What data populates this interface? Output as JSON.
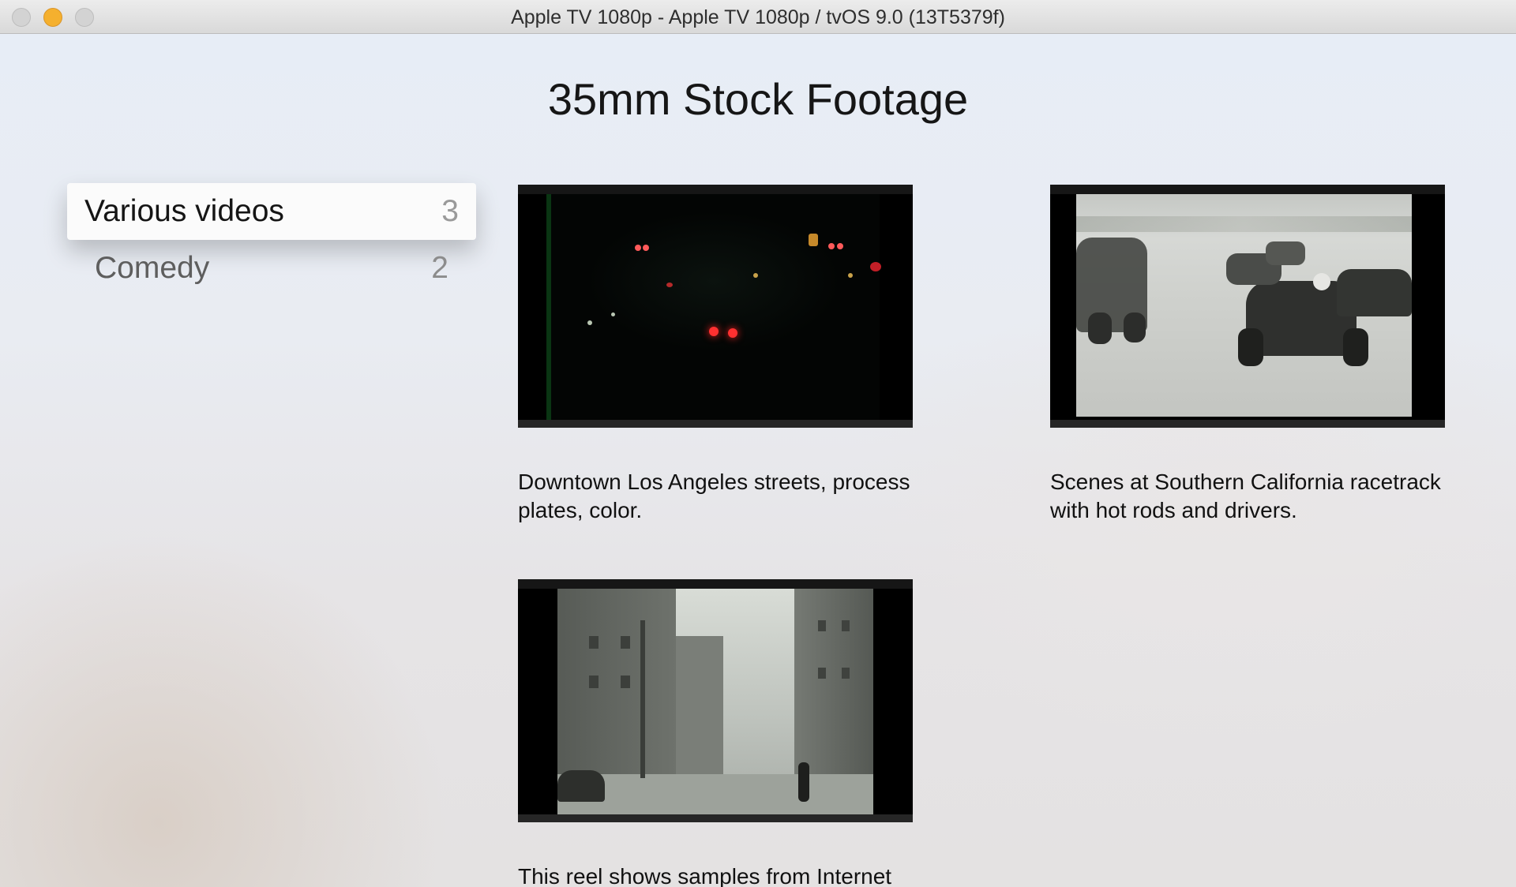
{
  "window": {
    "title": "Apple TV 1080p - Apple TV 1080p / tvOS 9.0 (13T5379f)"
  },
  "page": {
    "title": "35mm Stock Footage"
  },
  "sidebar": {
    "items": [
      {
        "label": "Various videos",
        "count": "3",
        "state": "focused"
      },
      {
        "label": "Comedy",
        "count": "2",
        "state": "normal"
      }
    ]
  },
  "videos": [
    {
      "caption": "Downtown Los Angeles streets, process plates, color."
    },
    {
      "caption": "Scenes at Southern California racetrack with hot rods and drivers."
    },
    {
      "caption": "This reel shows samples from Internet"
    }
  ],
  "colors": {
    "traffic_close": "#d3d3d3",
    "traffic_minimize": "#f5b02e",
    "traffic_zoom": "#d3d3d3",
    "focused_item_bg": "#fbfbfb"
  }
}
